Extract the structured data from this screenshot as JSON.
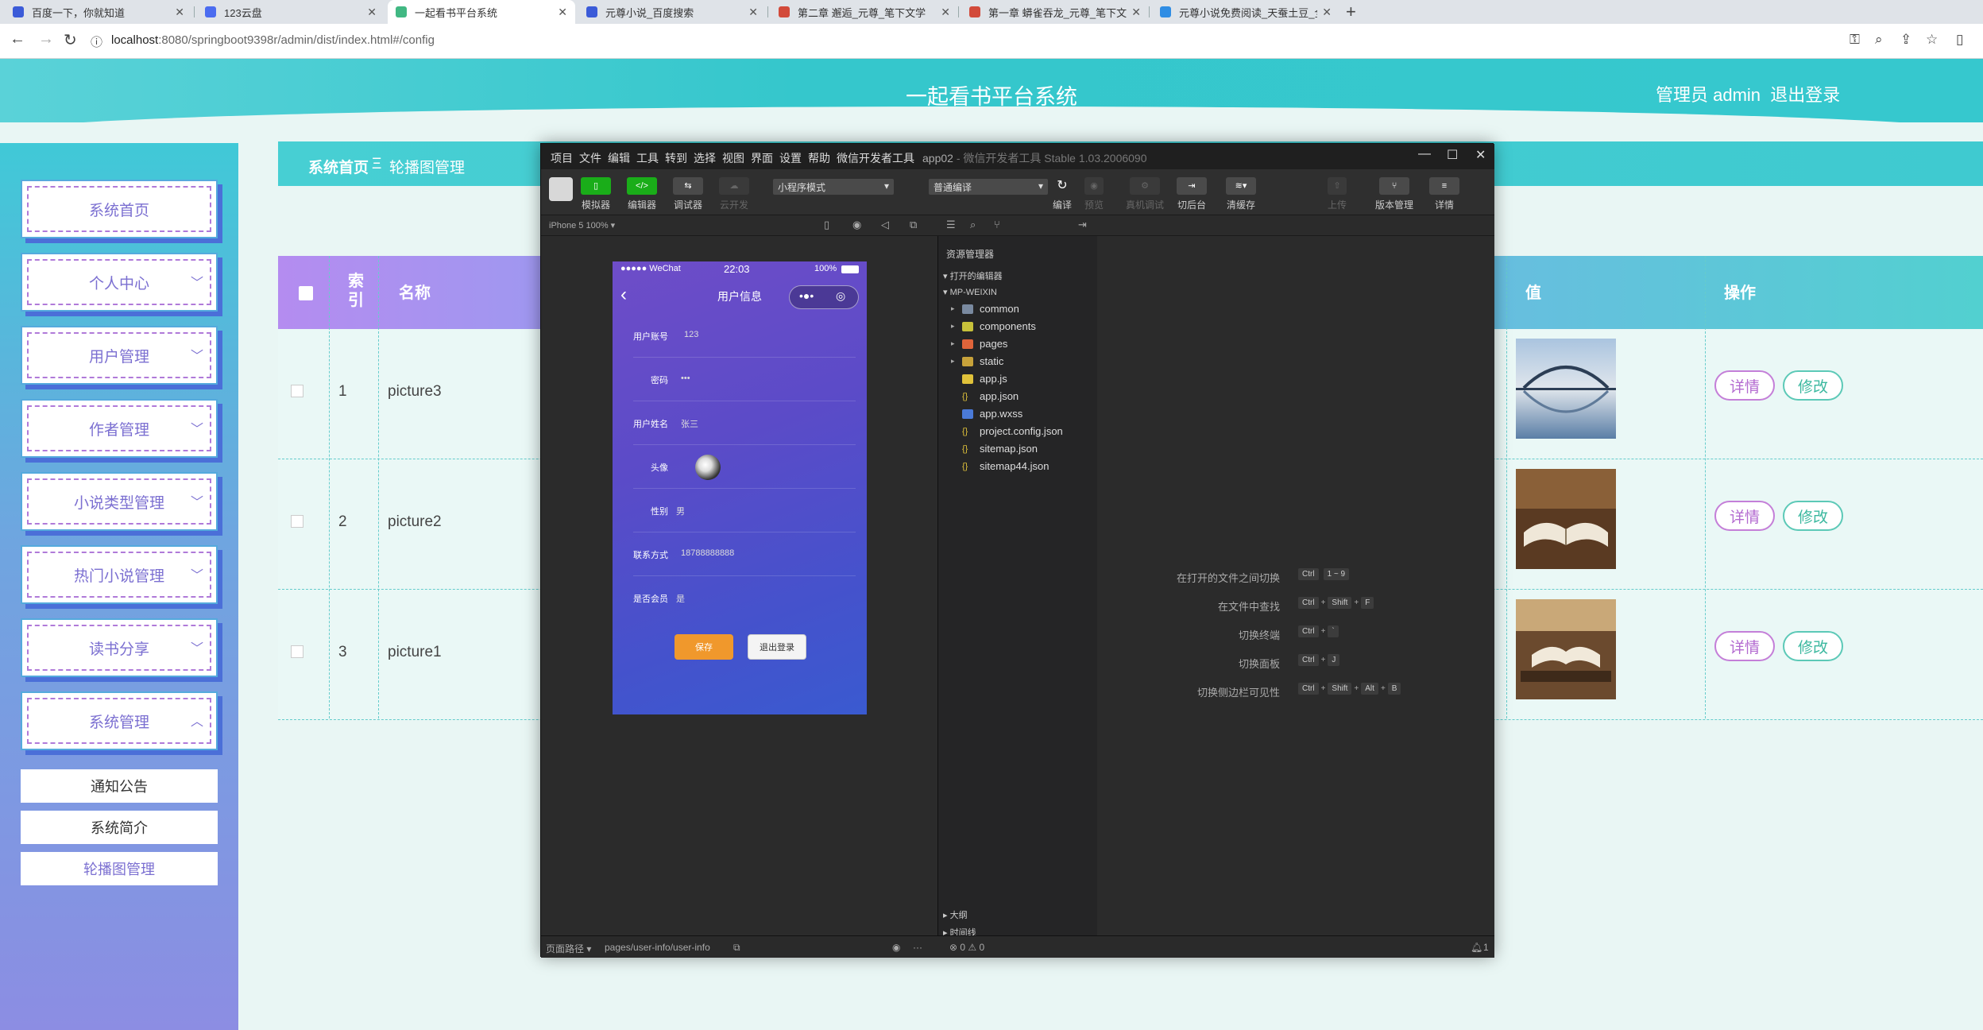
{
  "browser": {
    "tabs": [
      {
        "label": "百度一下，你就知道",
        "color": "#3b5bd8"
      },
      {
        "label": "123云盘",
        "color": "#4b6cf0"
      },
      {
        "label": "一起看书平台系统",
        "color": "#41b883"
      },
      {
        "label": "元尊小说_百度搜索",
        "color": "#3b5bd8"
      },
      {
        "label": "第二章 邂逅_元尊_笔下文学",
        "color": "#d24a3a"
      },
      {
        "label": "第一章 蟒雀吞龙_元尊_笔下文学",
        "color": "#d24a3a"
      },
      {
        "label": "元尊小说免费阅读_天蚕土豆_全...",
        "color": "#2f8de4"
      }
    ],
    "url_host": "localhost",
    "url_path": ":8080/springboot9398r/admin/dist/index.html#/config"
  },
  "app": {
    "title": "一起看书平台系统",
    "user_label": "管理员 admin",
    "logout": "退出登录"
  },
  "sidebar": {
    "items": [
      {
        "label": "系统首页"
      },
      {
        "label": "个人中心"
      },
      {
        "label": "用户管理"
      },
      {
        "label": "作者管理"
      },
      {
        "label": "小说类型管理"
      },
      {
        "label": "热门小说管理"
      },
      {
        "label": "读书分享"
      },
      {
        "label": "系统管理"
      }
    ],
    "sub_items": [
      {
        "label": "通知公告"
      },
      {
        "label": "系统简介"
      },
      {
        "label": "轮播图管理"
      }
    ]
  },
  "breadcrumb": {
    "home": "系统首页",
    "sep": "Ξ",
    "current": "轮播图管理"
  },
  "table": {
    "headers": {
      "index": "索引",
      "name": "名称",
      "value": "值",
      "actions": "操作"
    },
    "rows": [
      {
        "index": "1",
        "name": "picture3"
      },
      {
        "index": "2",
        "name": "picture2"
      },
      {
        "index": "3",
        "name": "picture1"
      }
    ],
    "detail_label": "详情",
    "edit_label": "修改"
  },
  "devtools": {
    "menu": [
      "项目",
      "文件",
      "编辑",
      "工具",
      "转到",
      "选择",
      "视图",
      "界面",
      "设置",
      "帮助",
      "微信开发者工具"
    ],
    "app_name": "app02",
    "app_suffix": "- 微信开发者工具 Stable 1.03.2006090",
    "toolbar": {
      "simulator": "模拟器",
      "editor": "编辑器",
      "debugger": "调试器",
      "cloud": "云开发",
      "mode": "小程序模式",
      "compile_mode": "普通编译",
      "compile": "编译",
      "preview": "预览",
      "remote_debug": "真机调试",
      "background": "切后台",
      "clear_cache": "清缓存",
      "upload": "上传",
      "version": "版本管理",
      "details": "详情"
    },
    "device": "iPhone 5 100% ▾",
    "explorer_title": "资源管理器",
    "open_editors": "打开的编辑器",
    "project": "MP-WEIXIN",
    "files": [
      {
        "name": "common",
        "type": "folder",
        "color": "#7a8aa0"
      },
      {
        "name": "components",
        "type": "folder",
        "color": "#c7c13a"
      },
      {
        "name": "pages",
        "type": "folder",
        "color": "#e0643a"
      },
      {
        "name": "static",
        "type": "folder",
        "color": "#c7a23a"
      },
      {
        "name": "app.js",
        "type": "file",
        "color": "#e0c23a"
      },
      {
        "name": "app.json",
        "type": "json",
        "color": "#e0c23a"
      },
      {
        "name": "app.wxss",
        "type": "file",
        "color": "#4a7ad8"
      },
      {
        "name": "project.config.json",
        "type": "json",
        "color": "#e0c23a"
      },
      {
        "name": "sitemap.json",
        "type": "json",
        "color": "#e0c23a"
      },
      {
        "name": "sitemap44.json",
        "type": "json",
        "color": "#e0c23a"
      }
    ],
    "outline": "大纲",
    "timeline": "时间线",
    "shortcuts": [
      {
        "label": "在打开的文件之间切换",
        "keys": [
          "Ctrl",
          "1 ~ 9"
        ]
      },
      {
        "label": "在文件中查找",
        "keys": [
          "Ctrl",
          "+",
          "Shift",
          "+",
          "F"
        ]
      },
      {
        "label": "切换终端",
        "keys": [
          "Ctrl",
          "+",
          "`"
        ]
      },
      {
        "label": "切换面板",
        "keys": [
          "Ctrl",
          "+",
          "J"
        ]
      },
      {
        "label": "切换侧边栏可见性",
        "keys": [
          "Ctrl",
          "+",
          "Shift",
          "+",
          "Alt",
          "+",
          "B"
        ]
      }
    ],
    "footer": {
      "page_path_label": "页面路径 ▾",
      "page_path": "pages/user-info/user-info",
      "status": "⊗ 0 ⚠ 0",
      "notif": "1"
    }
  },
  "phone": {
    "carrier": "●●●●● WeChat",
    "time": "22:03",
    "battery": "100%",
    "title": "用户信息",
    "fields": [
      {
        "label": "用户账号",
        "value": "123"
      },
      {
        "label": "密码",
        "value": "•••"
      },
      {
        "label": "用户姓名",
        "value": "张三"
      },
      {
        "label": "头像",
        "value": ""
      },
      {
        "label": "性别",
        "value": "男"
      },
      {
        "label": "联系方式",
        "value": "18788888888"
      },
      {
        "label": "是否会员",
        "value": "是"
      }
    ],
    "save": "保存",
    "logout": "退出登录"
  }
}
